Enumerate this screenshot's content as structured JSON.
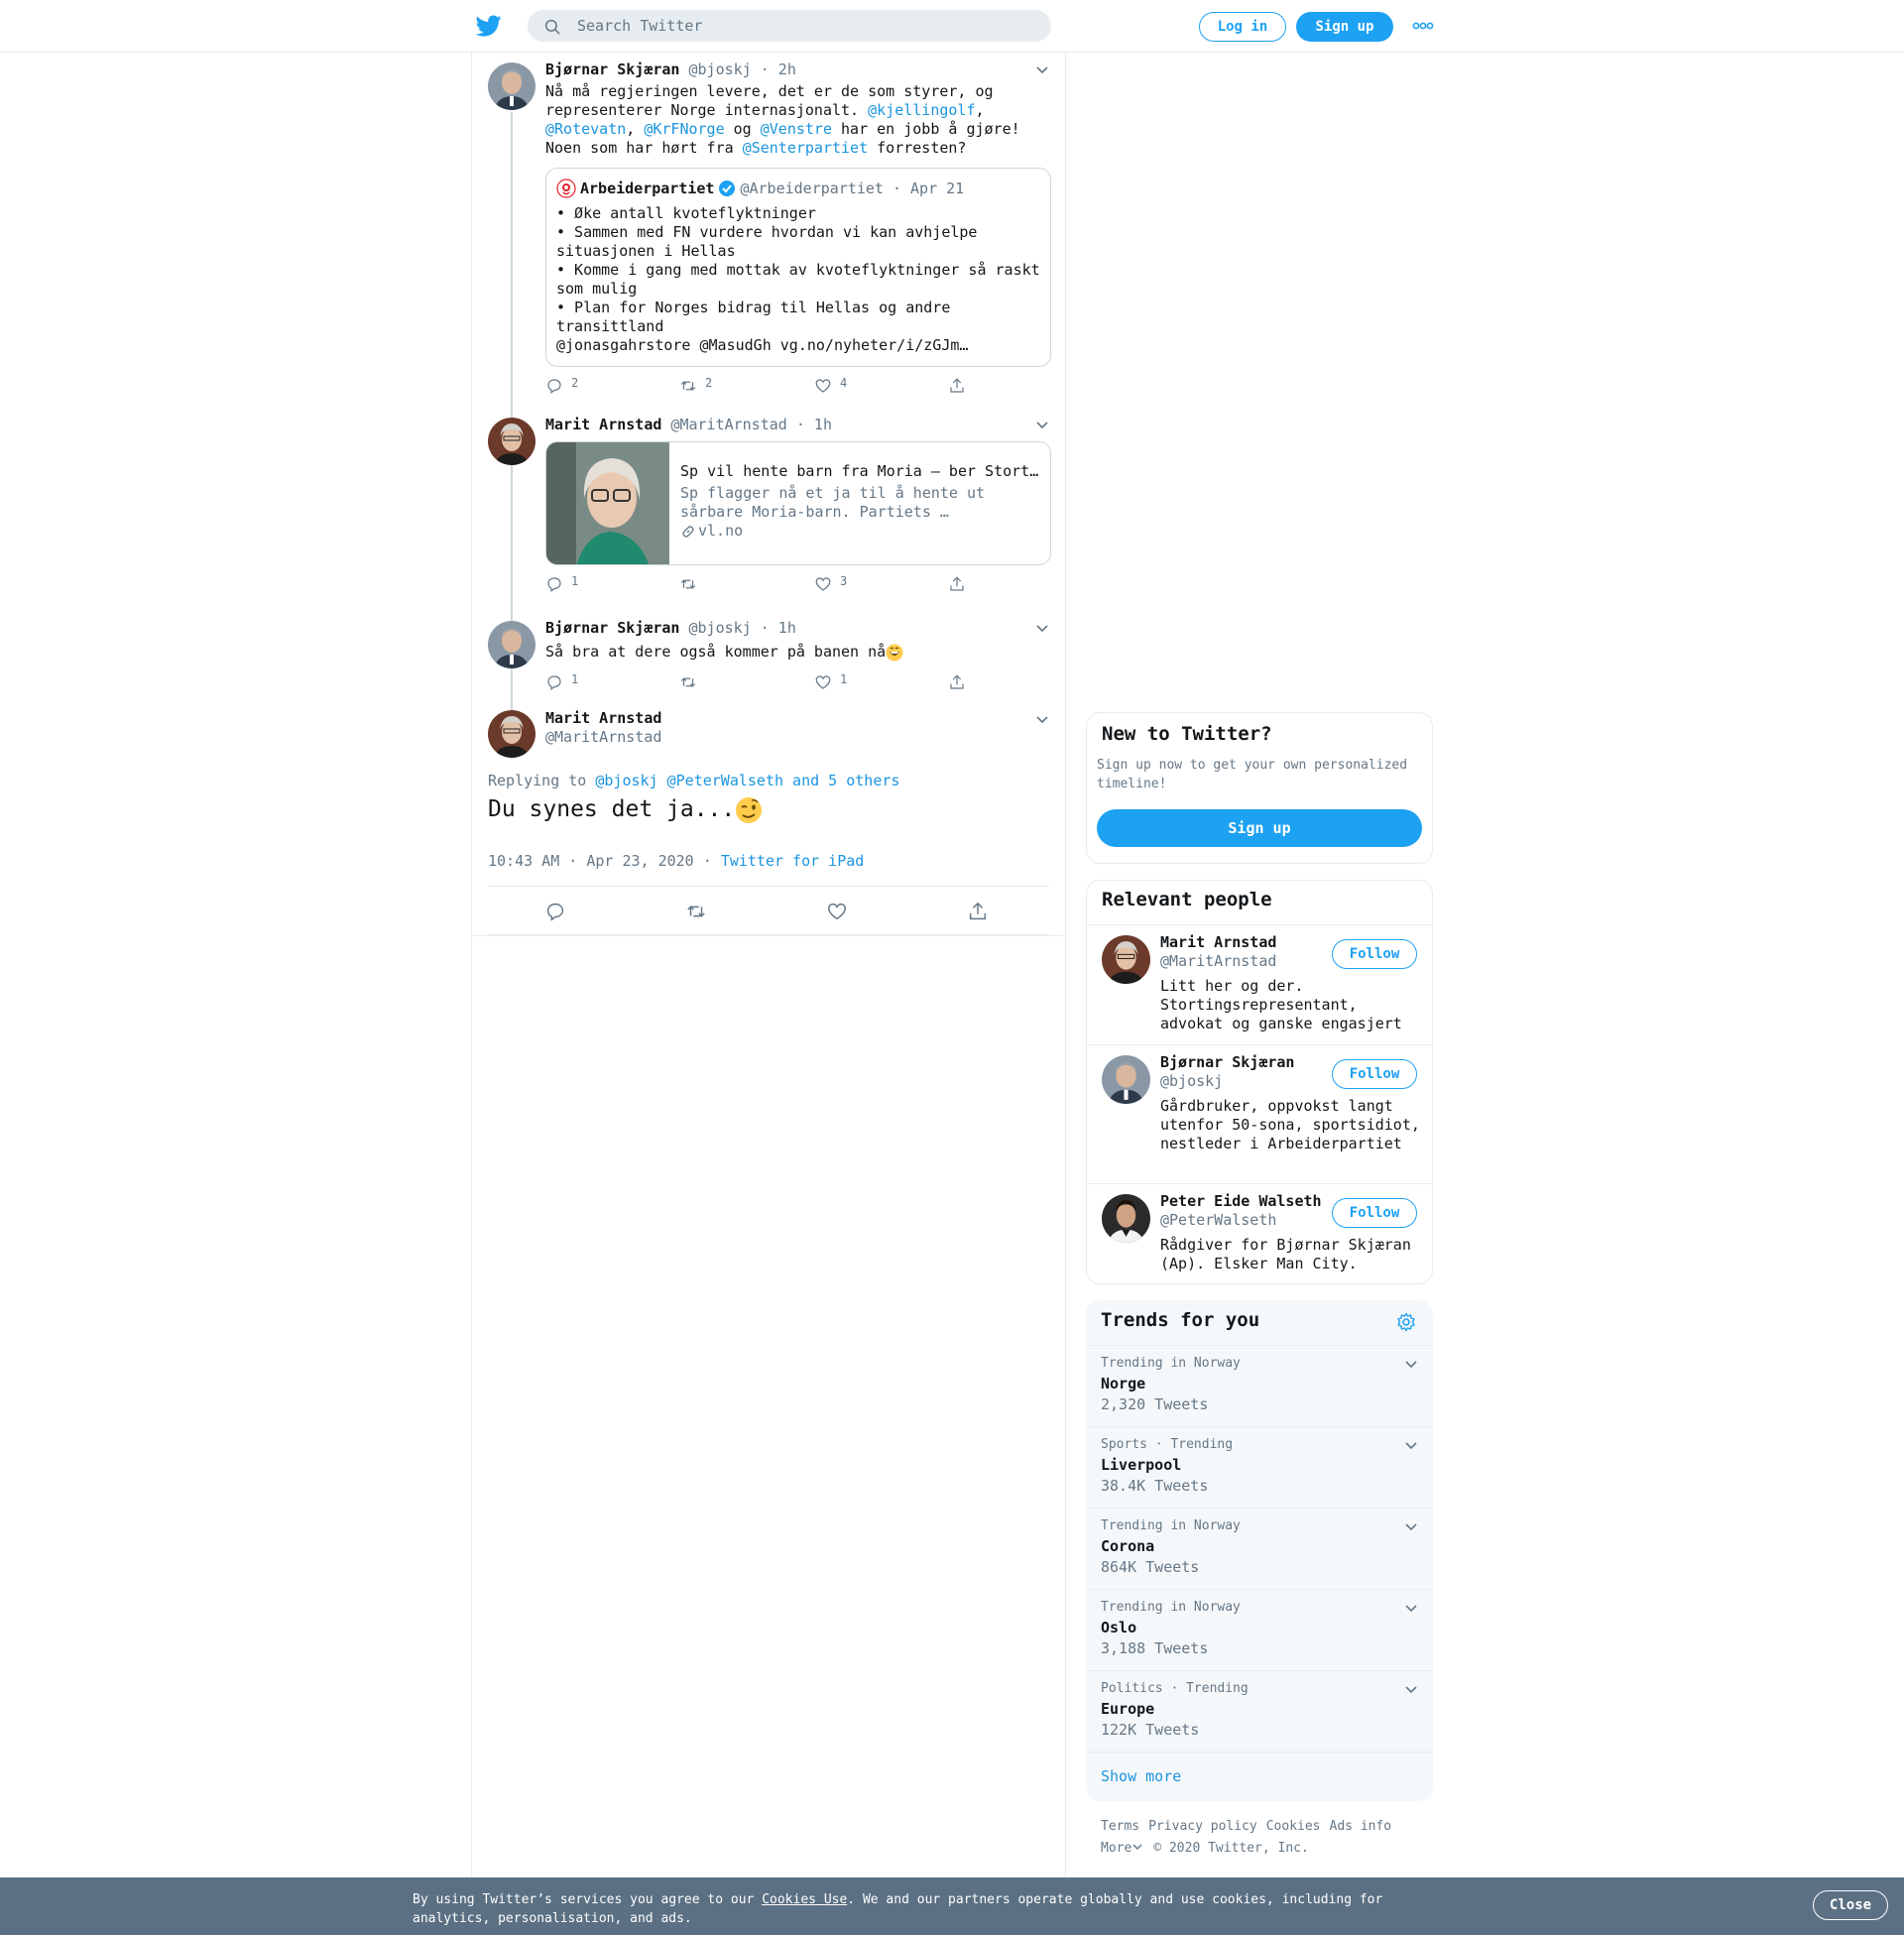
{
  "header": {
    "search_placeholder": "Search Twitter",
    "login_label": "Log in",
    "signup_label": "Sign up"
  },
  "thread": [
    {
      "name": "Bjørnar Skjæran",
      "handle": "@bjoskj",
      "time": "· 2h",
      "text_parts": [
        "Nå må regjeringen levere, det er de som styrer, og representerer Norge internasjonalt. ",
        "@kjellingolf",
        ", ",
        "@Rotevatn",
        ", ",
        "@KrFNorge",
        " og ",
        "@Venstre",
        " har en jobb å gjøre! Noen som har hørt fra ",
        "@Senterpartiet",
        " forresten?"
      ],
      "quote": {
        "name": "Arbeiderpartiet",
        "handle": "@Arbeiderpartiet",
        "time": "· Apr 21",
        "lines": [
          "• Øke antall kvoteflyktninger",
          "• Sammen med FN vurdere hvordan vi kan avhjelpe situasjonen i Hellas",
          "• Komme i gang med mottak av kvoteflyktninger så raskt som mulig",
          "• Plan for Norges bidrag til Hellas og andre transittland",
          "@jonasgahrstore @MasudGh vg.no/nyheter/i/zGJm…"
        ]
      },
      "replies": "2",
      "retweets": "2",
      "likes": "4"
    },
    {
      "name": "Marit Arnstad",
      "handle": "@MaritArnstad",
      "time": "· 1h",
      "card": {
        "title": "Sp vil hente barn fra Moria – ber Stort…",
        "description": "Sp flagger nå et ja til å hente ut sårbare Moria-barn. Partiets …",
        "domain": "vl.no"
      },
      "replies": "1",
      "retweets": "",
      "likes": "3"
    },
    {
      "name": "Bjørnar Skjæran",
      "handle": "@bjoskj",
      "time": "· 1h",
      "text": "Så bra at dere også kommer på banen nå",
      "replies": "1",
      "retweets": "",
      "likes": "1"
    }
  ],
  "focus": {
    "name": "Marit Arnstad",
    "handle": "@MaritArnstad",
    "replying_prefix": "Replying to ",
    "replying_targets": "@bjoskj @PeterWalseth and 5 others",
    "text": "Du synes det ja...",
    "timestamp": "10:43 AM · Apr 23, 2020",
    "separator": " · ",
    "source": "Twitter for iPad"
  },
  "sidebar": {
    "new_title": "New to Twitter?",
    "new_subtitle": "Sign up now to get your own personalized timeline!",
    "new_button": "Sign up",
    "relevant_title": "Relevant people",
    "people": [
      {
        "name": "Marit Arnstad",
        "handle": "@MaritArnstad",
        "bio": "Litt her og der. Stortingsrepresentant, advokat og ganske engasjert",
        "follow": "Follow"
      },
      {
        "name": "Bjørnar Skjæran",
        "handle": "@bjoskj",
        "bio": "Gårdbruker, oppvokst langt utenfor 50-sona, sportsidiot, nestleder i Arbeiderpartiet",
        "follow": "Follow"
      },
      {
        "name": "Peter Eide Walseth",
        "handle": "@PeterWalseth",
        "bio": "Rådgiver for Bjørnar Skjæran (Ap). Elsker Man City.",
        "follow": "Follow"
      }
    ],
    "trends_title": "Trends for you",
    "trends": [
      {
        "context": "Trending in Norway",
        "name": "Norge",
        "count": "2,320 Tweets"
      },
      {
        "context": "Sports · Trending",
        "name": "Liverpool",
        "count": "38.4K Tweets"
      },
      {
        "context": "Trending in Norway",
        "name": "Corona",
        "count": "864K Tweets"
      },
      {
        "context": "Trending in Norway",
        "name": "Oslo",
        "count": "3,188 Tweets"
      },
      {
        "context": "Politics · Trending",
        "name": "Europe",
        "count": "122K Tweets"
      }
    ],
    "show_more": "Show more",
    "footer": [
      "Terms",
      "Privacy policy",
      "Cookies",
      "Ads info"
    ],
    "footer_more": "More",
    "copyright": "© 2020 Twitter, Inc."
  },
  "cookie": {
    "text_before": "By using Twitter’s services you agree to our ",
    "link": "Cookies Use",
    "text_after": ". We and our partners operate globally and use cookies, including for analytics, personalisation, and ads.",
    "close": "Close"
  },
  "colors": {
    "accent": "#1da1f2",
    "link": "#1b95e0",
    "muted": "#657786",
    "cookie_bar": "#5b7083"
  }
}
